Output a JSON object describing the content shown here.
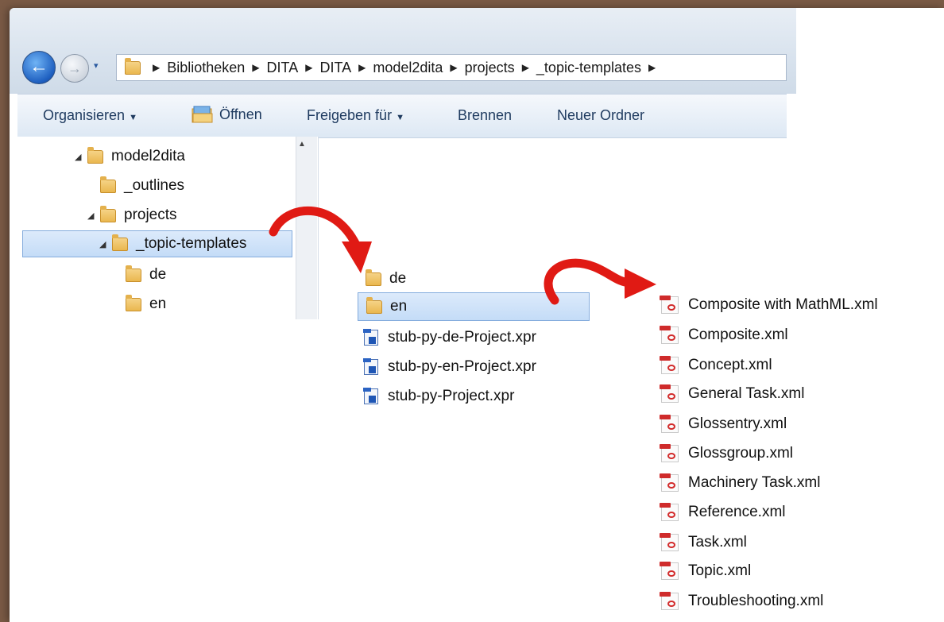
{
  "nav": {
    "back_glyph": "←",
    "forward_glyph": "→",
    "dropdown_glyph": "▾",
    "back_icon": "back-arrow-icon",
    "forward_icon": "forward-arrow-icon"
  },
  "breadcrumbs": [
    "Bibliotheken",
    "DITA",
    "DITA",
    "model2dita",
    "projects",
    "_topic-templates"
  ],
  "toolbar": {
    "organize": "Organisieren",
    "open": "Öffnen",
    "share": "Freigeben für",
    "burn": "Brennen",
    "new_folder": "Neuer Ordner"
  },
  "tree": [
    {
      "label": "model2dita",
      "expanded": true
    },
    {
      "label": "_outlines",
      "expanded": false
    },
    {
      "label": "projects",
      "expanded": true
    },
    {
      "label": "_topic-templates",
      "expanded": true,
      "selected": true
    },
    {
      "label": "de",
      "expanded": false
    },
    {
      "label": "en",
      "expanded": false
    }
  ],
  "folder_contents": [
    {
      "label": "de",
      "type": "folder"
    },
    {
      "label": "en",
      "type": "folder",
      "selected": true
    },
    {
      "label": "stub-py-de-Project.xpr",
      "type": "xpr"
    },
    {
      "label": "stub-py-en-Project.xpr",
      "type": "xpr"
    },
    {
      "label": "stub-py-Project.xpr",
      "type": "xpr"
    }
  ],
  "en_contents": [
    "Composite with MathML.xml",
    "Composite.xml",
    "Concept.xml",
    "General Task.xml",
    "Glossentry.xml",
    "Glossgroup.xml",
    "Machinery Task.xml",
    "Reference.xml",
    "Task.xml",
    "Topic.xml",
    "Troubleshooting.xml"
  ],
  "colors": {
    "arrow": "#e01a14",
    "selection": "#c4dcf7",
    "toolbar_text": "#1e3a5f"
  }
}
